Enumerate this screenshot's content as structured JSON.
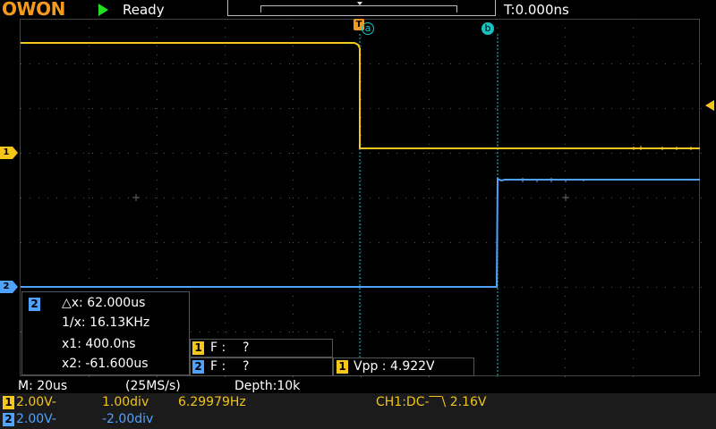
{
  "header": {
    "logo": "OWON",
    "run_state": "Ready",
    "trigger_time": "T:0.000ns"
  },
  "cursors": {
    "trigger_marker": "T",
    "cursor_a": "a",
    "cursor_b": "b"
  },
  "channel_markers": {
    "ch1": "1",
    "ch2": "2"
  },
  "cursor_panel": {
    "channel": "2",
    "delta_x": "△x: 62.000us",
    "inv_x": "1/x: 16.13KHz",
    "x1": "x1: 400.0ns",
    "x2": "x2: -61.600us"
  },
  "measure": {
    "ch1_freq_label": "F :",
    "ch1_freq_value": "?",
    "ch2_freq_label": "F :",
    "ch2_freq_value": "?",
    "ch1_vpp": "Vpp : 4.922V",
    "ch1_num": "1",
    "ch2_num": "2"
  },
  "status": {
    "timebase": "M: 20us",
    "sample_rate": "(25MS/s)",
    "depth": "Depth:10k",
    "ch1_num": "1",
    "ch1_volts": "2.00V-",
    "ch1_pos": "1.00div",
    "freq": "6.29979Hz",
    "trigger": "CH1:DC-⎺\\ 2.16V",
    "ch2_num": "2",
    "ch2_volts": "2.00V-",
    "ch2_pos": "-2.00div"
  },
  "colors": {
    "ch1": "#f6c71b",
    "ch2": "#4fa3ff",
    "cursor": "#19c3c3",
    "grid": "#444444"
  }
}
